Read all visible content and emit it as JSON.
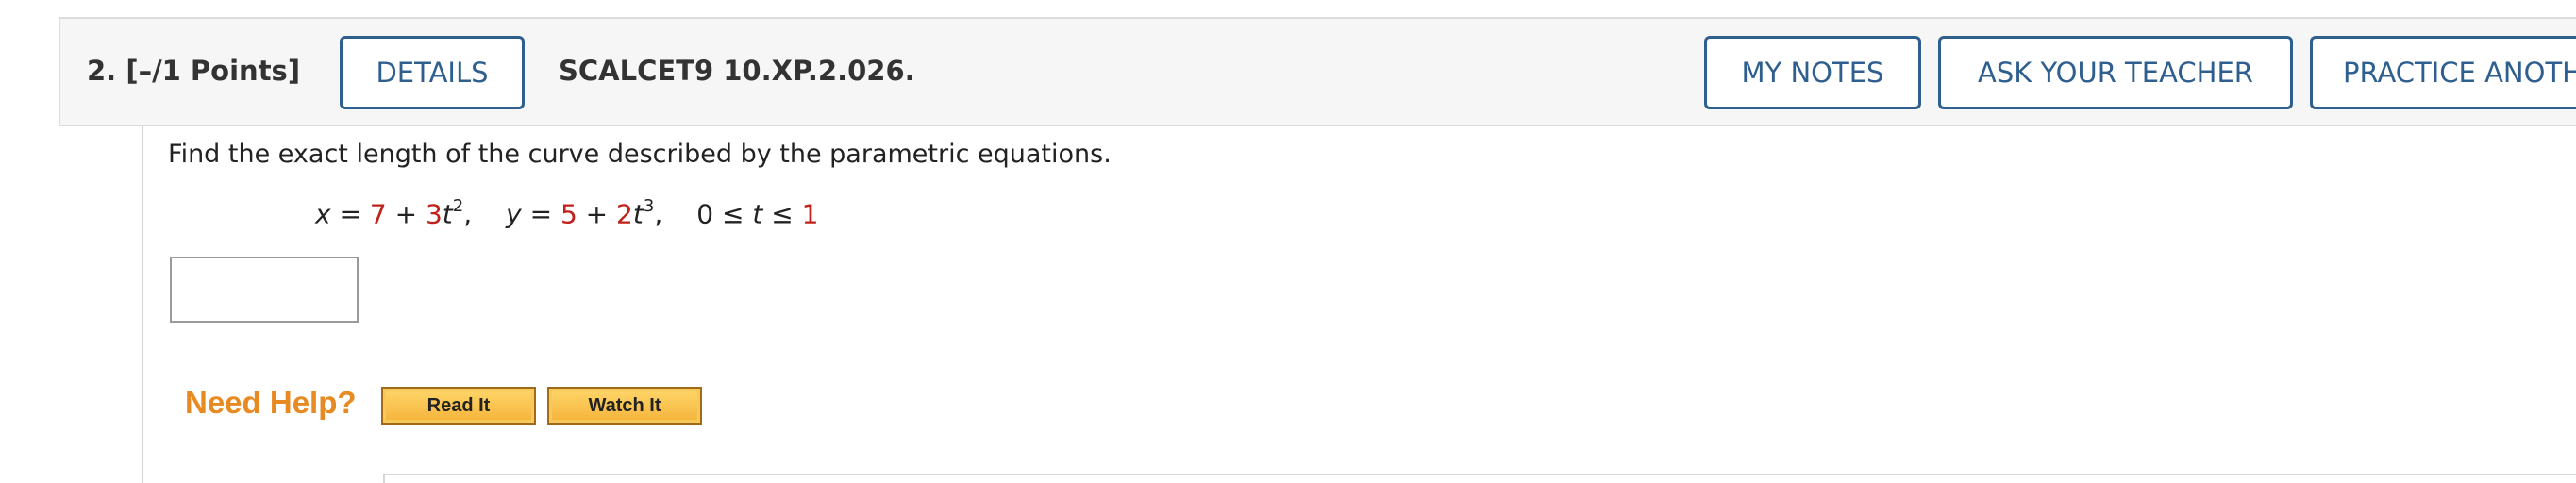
{
  "question": {
    "number_label": "2.",
    "points_label": "[–/1 Points]",
    "code": "SCALCET9 10.XP.2.026."
  },
  "header_buttons": {
    "details": "DETAILS",
    "my_notes": "MY NOTES",
    "ask_teacher": "ASK YOUR TEACHER",
    "practice_another": "PRACTICE ANOTHER"
  },
  "problem": {
    "prompt": "Find the exact length of the curve described by the parametric equations.",
    "equation": {
      "x_var": "x",
      "x_eq": " = ",
      "x_const": "7",
      "x_plus": " + ",
      "x_coef": "3",
      "x_t": "t",
      "x_exp": "2",
      "x_comma": ",",
      "y_var": "y",
      "y_eq": " = ",
      "y_const": "5",
      "y_plus": " + ",
      "y_coef": "2",
      "y_t": "t",
      "y_exp": "3",
      "y_comma": ",",
      "range_low": "0",
      "range_le1": " ≤ ",
      "range_t": "t",
      "range_le2": " ≤ ",
      "range_high": "1"
    },
    "answer_value": ""
  },
  "help": {
    "label": "Need Help?",
    "read_it": "Read It",
    "watch_it": "Watch It"
  },
  "colors": {
    "accent_blue": "#2e5f8e",
    "highlight_red": "#c0201a",
    "help_orange": "#e88a22"
  }
}
